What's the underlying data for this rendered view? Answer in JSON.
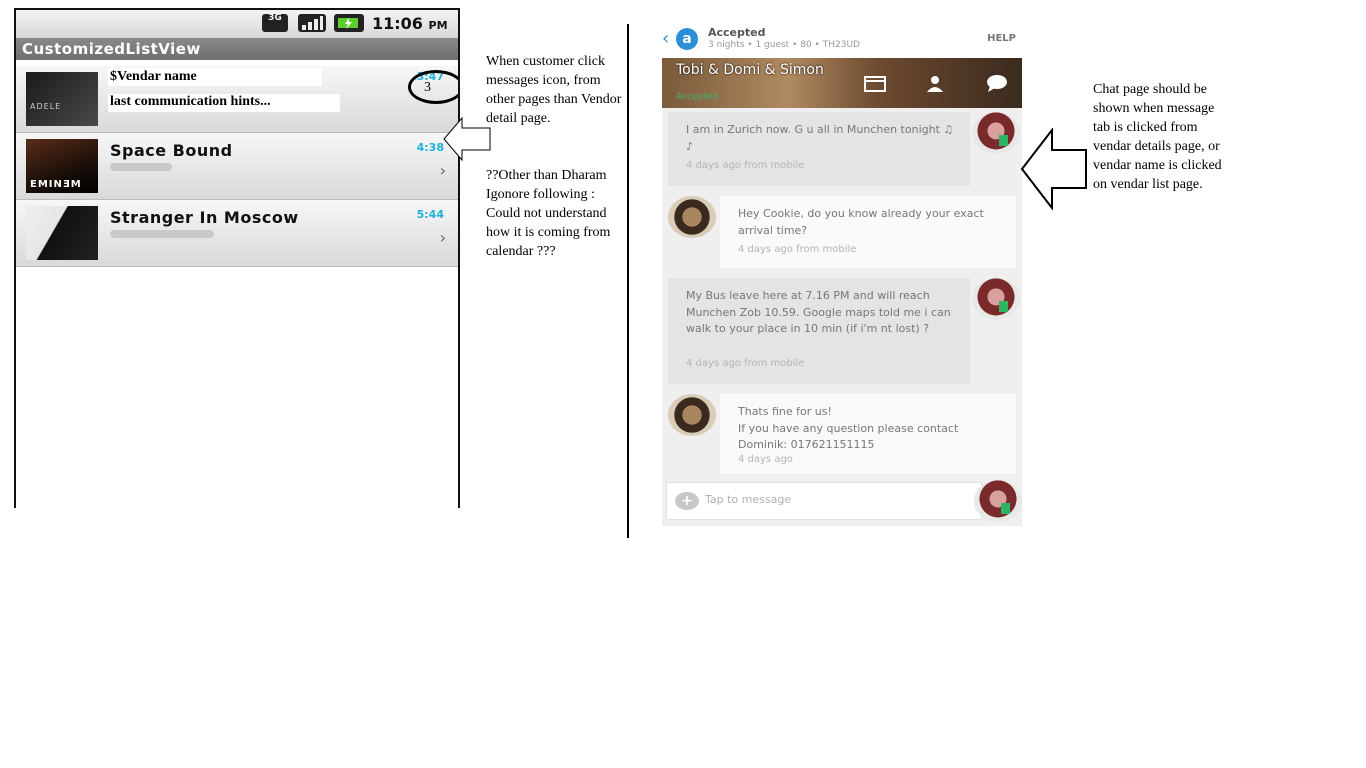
{
  "phone": {
    "status_time": "11:06",
    "status_ampm": "PM",
    "network": "3G",
    "app_title": "CustomizedListView",
    "rows": [
      {
        "vendor_name": "$Vendar name",
        "last_comm": "last communication hints...",
        "time": "3:47",
        "badge": "3"
      },
      {
        "title": "Space Bound",
        "time": "4:38",
        "thumb_text": "EMINƎM"
      },
      {
        "title": "Stranger In Moscow",
        "time": "5:44"
      }
    ],
    "adele_text": "ADELE"
  },
  "notes": {
    "left1": "When customer click messages icon, from other pages than Vendor detail page.",
    "left2": "??Other than Dharam Igonore following : Could not understand how it is coming from calendar ???",
    "right": "Chat page should be shown when message tab is clicked from vendar details page, or vendar name is clicked on vendar list page."
  },
  "chat": {
    "top_title": "Accepted",
    "top_sub": "3 nights • 1 guest • 80 • TH23UD",
    "help": "HELP",
    "banner_title": "Tobi & Domi & Simon",
    "banner_status": "Accepted",
    "messages": [
      {
        "text": "I am in Zurich now. G u all in Munchen tonight ♫ ♪",
        "meta": "4 days ago from mobile"
      },
      {
        "text": "Hey Cookie, do you know already your exact arrival time?",
        "meta": "4 days ago from mobile"
      },
      {
        "text": "My Bus leave here at 7.16 PM and will reach Munchen Zob 10.59. Google maps told me i can walk to your place in 10 min (if i'm nt lost) ?",
        "meta": "4 days ago from mobile"
      },
      {
        "text": "Thats fine for us!\nIf you have any question please contact Dominik: 017621151115",
        "meta": "4 days ago"
      }
    ],
    "input_placeholder": "Tap to message"
  },
  "icons": {
    "back": "chevron-left-icon",
    "logo": "airbnb-logo-icon",
    "calendar": "calendar-icon",
    "person": "person-icon",
    "chat": "chat-bubble-icon",
    "plus": "plus-icon",
    "arrow": "hollow-arrow-left-icon"
  },
  "colors": {
    "accent_blue": "#2a8fd6",
    "time_cyan": "#1fb2d8",
    "accepted_green": "#3cb371"
  }
}
